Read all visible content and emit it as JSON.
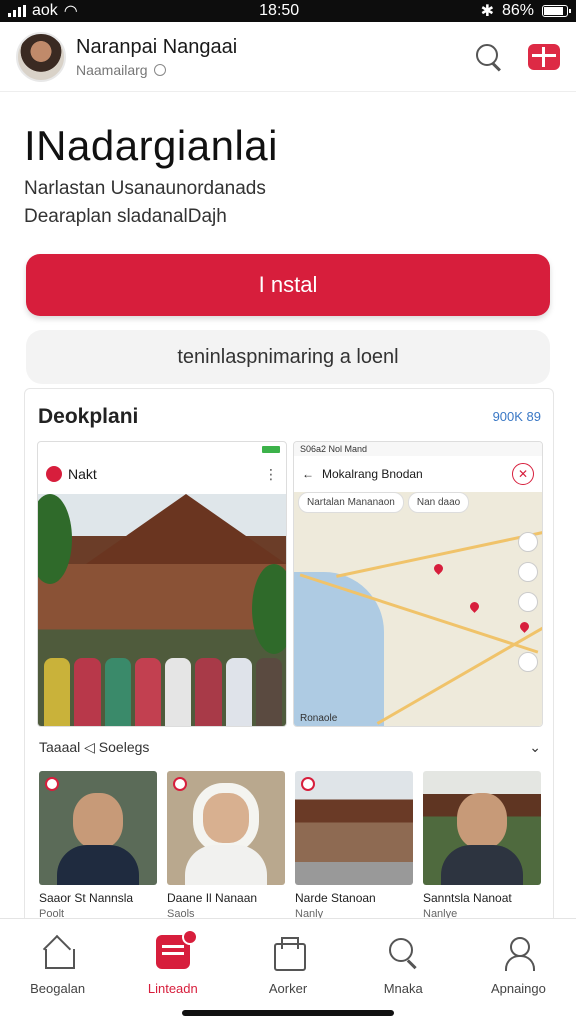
{
  "status_bar": {
    "carrier": "aok",
    "time": "18:50",
    "battery_text": "86%",
    "battery_level": 0.86
  },
  "header": {
    "title": "Naranpai Nangaai",
    "subtitle": "Naamailarg",
    "icons": [
      "avatar",
      "globe-icon",
      "search-icon",
      "store-icon"
    ]
  },
  "app": {
    "title": "INadargianlai",
    "description_line1": "Narlastan Usanaunordanads",
    "description_line2": "Dearaplan sladanalDajh",
    "install_label": "I nstal",
    "secondary_label": "teninlaspnimaring a loenl"
  },
  "preview": {
    "title": "Deokplani",
    "meta": "900K 89",
    "screenshot_left": {
      "header_label": "Nakt"
    },
    "screenshot_right": {
      "status_text": "S06a2 Nol Mand",
      "bar_title": "Mokalrang Bnodan",
      "chips": [
        "Nartalan Mananaon",
        "Nan daao"
      ],
      "credit": "Ronaole"
    },
    "section_label": "Taaaal ◁ Soelegs",
    "thumbnails": [
      {
        "title": "Saaor St Nannsla",
        "sub": "Poolt"
      },
      {
        "title": "Daane Il Nanaan",
        "sub": "Saols"
      },
      {
        "title": "Narde Stanoan",
        "sub": "Nanly"
      },
      {
        "title": "Sanntsla Nanoat",
        "sub": "Nanlye"
      }
    ]
  },
  "bottom_nav": {
    "items": [
      {
        "label": "Beogalan",
        "icon": "home-icon"
      },
      {
        "label": "Linteadn",
        "icon": "apps-icon"
      },
      {
        "label": "Aorker",
        "icon": "box-icon"
      },
      {
        "label": "Mnaka",
        "icon": "search-icon"
      },
      {
        "label": "Apnaingo",
        "icon": "user-icon"
      }
    ],
    "active_index": 1
  },
  "colors": {
    "accent": "#d71e3c",
    "link": "#3a78c5",
    "status_bar": "#0d0d0d"
  }
}
